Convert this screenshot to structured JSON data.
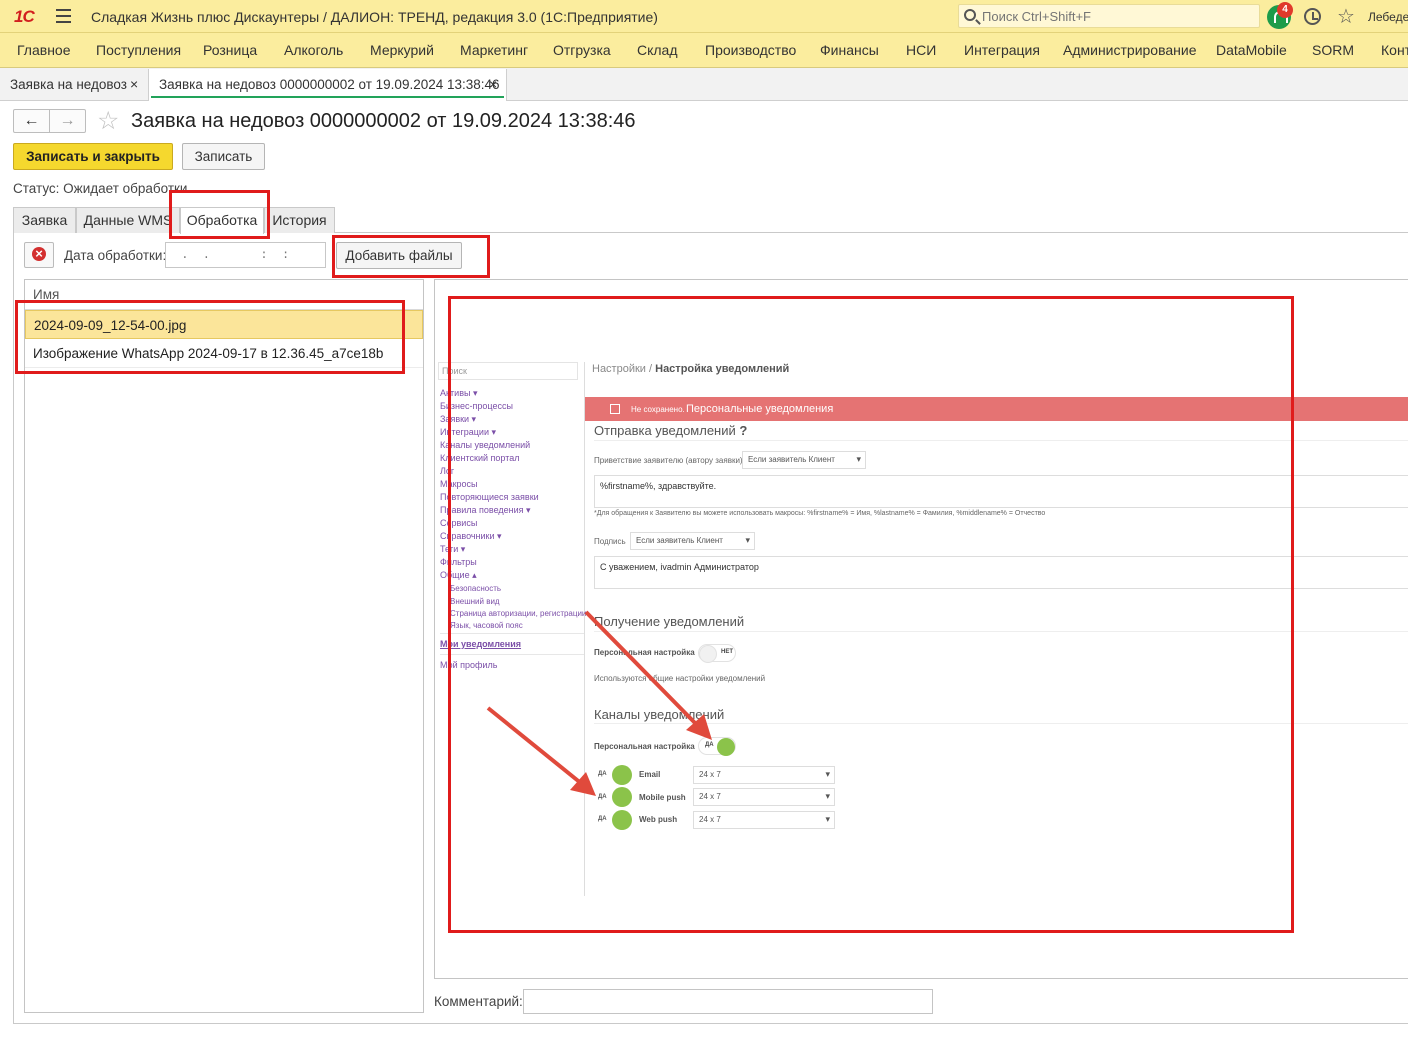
{
  "titlebar": {
    "logo": "1С",
    "title": "Сладкая Жизнь плюс Дискаунтеры / ДАЛИОН: ТРЕНД, редакция 3.0  (1С:Предприятие)",
    "search_placeholder": "Поиск Ctrl+Shift+F",
    "notifications_count": "4",
    "user": "Лебедев"
  },
  "menu": [
    "Главное",
    "Поступления",
    "Розница",
    "Алкоголь",
    "Меркурий",
    "Маркетинг",
    "Отгрузка",
    "Склад",
    "Производство",
    "Финансы",
    "НСИ",
    "Интеграция",
    "Администрирование",
    "DataMobile",
    "SORM",
    "Конт"
  ],
  "doc_tabs": [
    {
      "label": "Заявка на недовоз",
      "close": "×"
    },
    {
      "label": "Заявка на недовоз 0000000002 от 19.09.2024 13:38:46",
      "close": "×"
    }
  ],
  "form": {
    "title": "Заявка на недовоз 0000000002 от 19.09.2024 13:38:46",
    "nav_back": "←",
    "nav_forward": "→",
    "save_close": "Записать и закрыть",
    "save": "Записать",
    "status": "Статус:  Ожидает обработки",
    "tabs": [
      "Заявка",
      "Данные WMS",
      "Обработка",
      "История"
    ],
    "active_tab": "Обработка"
  },
  "processing": {
    "date_label": "Дата обработки:",
    "date_value": " .  .       :  :",
    "add_files": "Добавить файлы",
    "files_header": "Имя",
    "files": [
      "2024-09-09_12-54-00.jpg",
      "Изображение WhatsApp 2024-09-17 в 12.36.45_a7ce18b"
    ],
    "selected_file": "2024-09-09_12-54-00.jpg",
    "comment_label": "Комментарий:",
    "comment_value": ""
  },
  "preview": {
    "search": "Поиск",
    "nav": [
      "Активы ▾",
      "Бизнес-процессы",
      "Заявки ▾",
      "Интеграции ▾",
      "Каналы уведомлений",
      "Клиентский портал",
      "Лог",
      "Макросы",
      "Повторяющиеся заявки",
      "Правила поведения ▾",
      "Сервисы",
      "Справочники ▾",
      "Теги ▾",
      "Фильтры",
      "Общие ▴"
    ],
    "nav_sub": [
      "Безопасность",
      "Внешний вид",
      "Страница авторизации, регистрации",
      "Язык, часовой пояс"
    ],
    "nav_bottom": [
      "Мои уведомления",
      "Мой профиль"
    ],
    "breadcrumb_root": "Настройки",
    "breadcrumb_sep": "/",
    "breadcrumb_current": "Настройка уведомлений",
    "not_saved": "Не сохранено.",
    "bar_title": "Персональные уведомления",
    "section_send": "Отправка уведомлений",
    "greeting_label": "Приветствие заявителю (автору заявки)",
    "greeting_select": "Если заявитель Клиент",
    "greeting_text": "%firstname%, здравствуйте.",
    "macros_hint": "*Для обращения к Заявителю вы можете использовать макросы: %firstname% = Имя, %lastname% = Фамилия, %middlename% = Отчество",
    "signature_label": "Подпись",
    "signature_select": "Если заявитель Клиент",
    "signature_text": "С уважением, ivadmin Администратор",
    "section_receive": "Получение уведомлений",
    "personal_setting": "Персональная настройка",
    "toggle_off": "НЕТ",
    "common_hint": "Используются общие настройки уведомлений",
    "section_channels": "Каналы уведомлений",
    "toggle_on": "ДА",
    "channels": [
      {
        "name": "Email",
        "schedule": "24 x 7",
        "state": "ДА"
      },
      {
        "name": "Mobile push",
        "schedule": "24 x 7",
        "state": "ДА"
      },
      {
        "name": "Web push",
        "schedule": "24 x 7",
        "state": "ДА"
      }
    ]
  },
  "colors": {
    "accent_yellow": "#f5d82e",
    "header_bg": "#fbed9e",
    "annotation_red": "#e01b1b",
    "active_tab_line": "#22a35a"
  }
}
